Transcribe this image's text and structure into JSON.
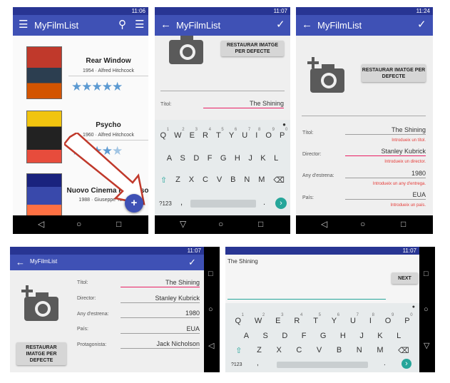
{
  "status_bar": {
    "s1_time": "11:06",
    "s2_time": "11:07",
    "s3_time": "11:24",
    "s4_time": "11:07",
    "s5_time": "11:07"
  },
  "app": {
    "title": "MyFilmList"
  },
  "films": [
    {
      "title": "Rear Window",
      "meta": "1954 · Alfred Hitchcock",
      "rating": 5
    },
    {
      "title": "Psycho",
      "meta": "1960 · Alfred Hitchcock",
      "rating": 4.5
    },
    {
      "title": "Nuovo Cinema Paradiso",
      "meta": "1988 · Giuseppe Tornatore",
      "rating": 0
    }
  ],
  "icons": {
    "menu": "☰",
    "search": "⚲",
    "sort": "☰",
    "back": "←",
    "check": "✓",
    "fab": "+",
    "nav_back": "◁",
    "nav_home": "○",
    "nav_recent": "□"
  },
  "edit": {
    "restore_button": "RESTAURAR IMATGE PER DEFECTE",
    "title_label": "Títol:",
    "title_value": "The Shining",
    "title_error": "Introdueix un títol.",
    "director_label": "Director:",
    "director_value": "Stanley Kubrick",
    "director_error": "Introdueix un director.",
    "year_label": "Any d'estrena:",
    "year_value": "1980",
    "year_error": "Introdueix un any d'entrega.",
    "country_label": "País:",
    "country_value": "EUA",
    "country_error": "Introdueix un país.",
    "cast_label": "Protagonista:",
    "cast_value": "Jack Nicholson"
  },
  "fullscreen_editor": {
    "text": "The Shining",
    "next_button": "NEXT"
  },
  "keyboard": {
    "row1": [
      "Q",
      "W",
      "E",
      "R",
      "T",
      "Y",
      "U",
      "I",
      "O",
      "P"
    ],
    "row1_hints": [
      "1",
      "2",
      "3",
      "4",
      "5",
      "6",
      "7",
      "8",
      "9",
      "0"
    ],
    "row2": [
      "A",
      "S",
      "D",
      "F",
      "G",
      "H",
      "J",
      "K",
      "L"
    ],
    "row3": [
      "Z",
      "X",
      "C",
      "V",
      "B",
      "N",
      "M"
    ],
    "sym": "?123",
    "comma": ",",
    "period": ".",
    "shift": "⇧",
    "delete": "⌫",
    "go": "›",
    "mic": "🎤"
  }
}
